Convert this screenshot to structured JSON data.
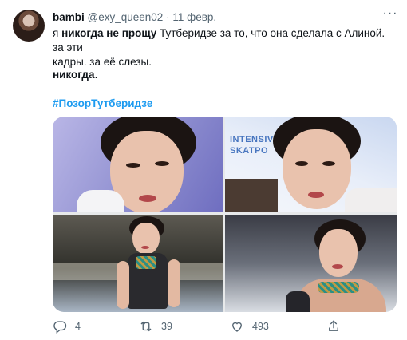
{
  "user": {
    "name": "bambi",
    "handle": "@exy_queen02",
    "separator": "·",
    "date": "11 февр."
  },
  "more_label": "···",
  "text": {
    "line1_prefix": "я ",
    "line1_bold": "никогда не прощу",
    "line1_rest": " Тутберидзе за то, что она сделала с Алиной. за эти",
    "line2": "кадры. за её слезы.",
    "emphasis": "никогда",
    "emphasis_end": ".",
    "hashtag": "#ПозорТутберидзе"
  },
  "media": {
    "sponsor_text": "INTENSIV\nSKATPO"
  },
  "actions": {
    "replies": "4",
    "retweets": "39",
    "likes": "493"
  },
  "icons": [
    "reply-icon",
    "retweet-icon",
    "like-icon",
    "share-icon",
    "more-icon"
  ],
  "colors": {
    "link": "#1d9bf0",
    "muted": "#536471",
    "text": "#0f1419"
  }
}
